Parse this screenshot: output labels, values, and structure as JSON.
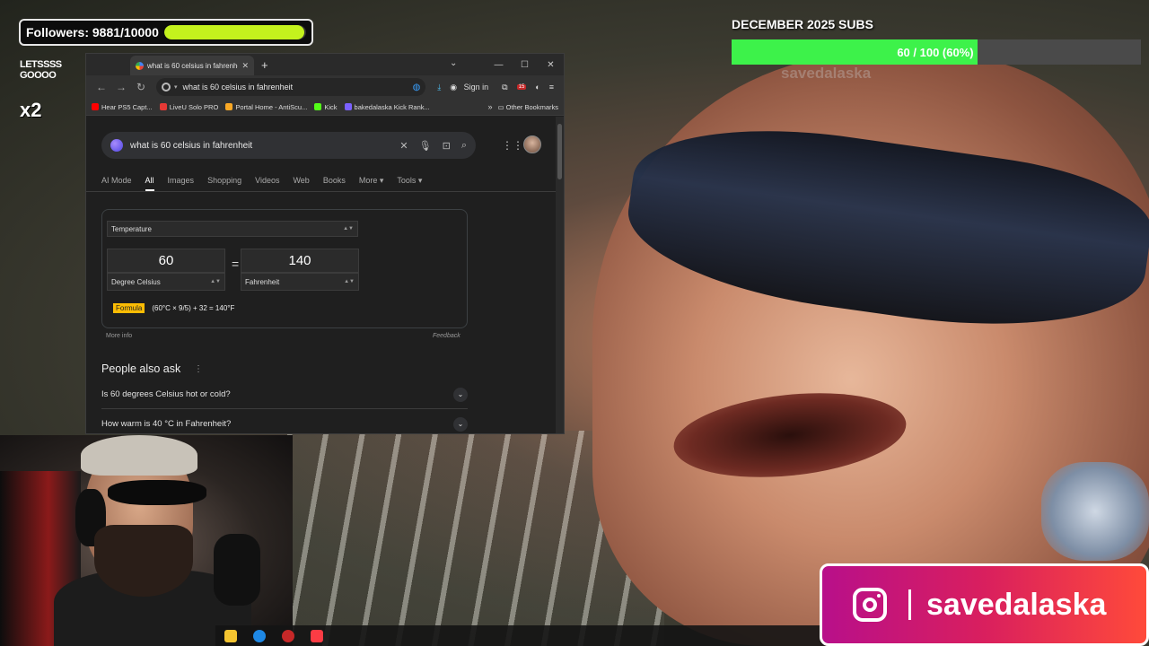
{
  "overlay": {
    "followers_label": "Followers: 9881/10000",
    "followers_progress": 0.9881,
    "badge_top": "LETSSSS GOOOO",
    "badge_multiplier": "x2",
    "subs_title": "DECEMBER 2025 SUBS",
    "subs_text": "60 / 100 (60%)",
    "subs_progress": 0.6,
    "ghost_handle": "savedalaska",
    "instagram_handle": "savedalaska"
  },
  "browser": {
    "tab_title": "what is 60 celsius in fahrenheit",
    "new_tab": "+",
    "url": "what is 60 celsius in fahrenheit",
    "sign_in": "Sign in",
    "ext_badge": "15",
    "bookmarks": [
      {
        "label": "Hear PS5 Capt...",
        "color": "#ff0000"
      },
      {
        "label": "LiveU Solo PRO",
        "color": "#e53935"
      },
      {
        "label": "Portal Home - AntiScu...",
        "color": "#f9a825"
      },
      {
        "label": "Kick",
        "color": "#53fc18"
      },
      {
        "label": "bakedalaska Kick Rank...",
        "color": "#7b61ff"
      }
    ],
    "other_bookmarks": "Other Bookmarks"
  },
  "google": {
    "query": "what is 60 celsius in fahrenheit",
    "tabs": [
      "AI Mode",
      "All",
      "Images",
      "Shopping",
      "Videos",
      "Web",
      "Books",
      "More ▾",
      "Tools ▾"
    ],
    "active_tab": "All",
    "converter": {
      "category": "Temperature",
      "from_value": "60",
      "to_value": "140",
      "from_unit": "Degree Celsius",
      "to_unit": "Fahrenheit",
      "equals": "=",
      "formula_tag": "Formula",
      "formula": "(60°C × 9/5) + 32 = 140°F"
    },
    "more_info": "More info",
    "feedback": "Feedback",
    "paa_title": "People also ask",
    "paa_items": [
      "Is 60 degrees Celsius hot or cold?",
      "How warm is 40 °C in Fahrenheit?"
    ]
  }
}
